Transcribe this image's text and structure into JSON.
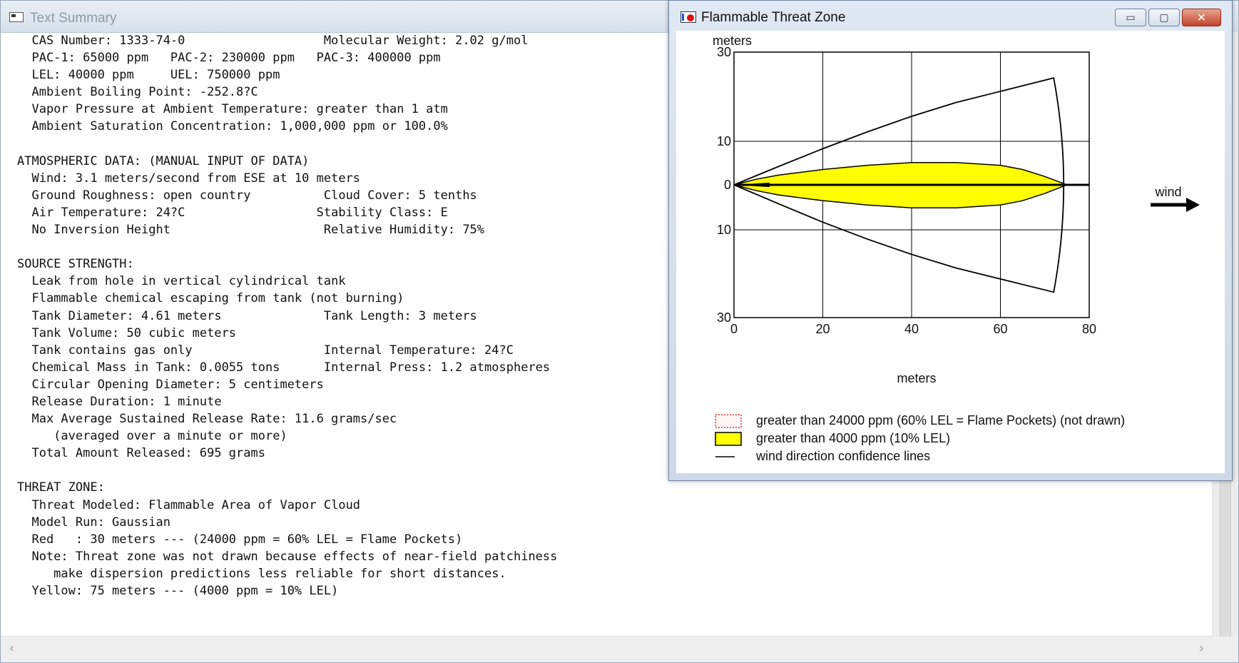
{
  "text_summary": {
    "title": "Text Summary",
    "lines": [
      "CAS Number: 1333-74-0                   Molecular Weight: 2.02 g/mol",
      "PAC-1: 65000 ppm   PAC-2: 230000 ppm   PAC-3: 400000 ppm",
      "LEL: 40000 ppm     UEL: 750000 ppm",
      "Ambient Boiling Point: -252.8?C",
      "Vapor Pressure at Ambient Temperature: greater than 1 atm",
      "Ambient Saturation Concentration: 1,000,000 ppm or 100.0%",
      "",
      "ATMOSPHERIC DATA: (MANUAL INPUT OF DATA)",
      "Wind: 3.1 meters/second from ESE at 10 meters",
      "Ground Roughness: open country          Cloud Cover: 5 tenths",
      "Air Temperature: 24?C                  Stability Class: E",
      "No Inversion Height                     Relative Humidity: 75%",
      "",
      "SOURCE STRENGTH:",
      "Leak from hole in vertical cylindrical tank",
      "Flammable chemical escaping from tank (not burning)",
      "Tank Diameter: 4.61 meters              Tank Length: 3 meters",
      "Tank Volume: 50 cubic meters",
      "Tank contains gas only                  Internal Temperature: 24?C",
      "Chemical Mass in Tank: 0.0055 tons      Internal Press: 1.2 atmospheres",
      "Circular Opening Diameter: 5 centimeters",
      "Release Duration: 1 minute",
      "Max Average Sustained Release Rate: 11.6 grams/sec",
      "   (averaged over a minute or more)",
      "Total Amount Released: 695 grams",
      "",
      "THREAT ZONE:",
      "Threat Modeled: Flammable Area of Vapor Cloud",
      "Model Run: Gaussian",
      "Red   : 30 meters --- (24000 ppm = 60% LEL = Flame Pockets)",
      "Note: Threat zone was not drawn because effects of near-field patchiness",
      "   make dispersion predictions less reliable for short distances.",
      "Yellow: 75 meters --- (4000 ppm = 10% LEL)"
    ],
    "indent": [
      2,
      2,
      2,
      2,
      2,
      2,
      0,
      0,
      2,
      2,
      2,
      2,
      0,
      0,
      2,
      2,
      2,
      2,
      2,
      2,
      2,
      2,
      2,
      2,
      2,
      0,
      0,
      2,
      2,
      2,
      2,
      2,
      2
    ]
  },
  "threat_zone": {
    "title": "Flammable Threat Zone",
    "buttons": {
      "minimize": "▭",
      "maximize": "▢",
      "close": "✕"
    },
    "y_unit_label": "meters",
    "x_axis_label": "meters",
    "wind_label": "wind",
    "x_ticks": [
      "0",
      "20",
      "40",
      "60",
      "80"
    ],
    "y_ticks": [
      "30",
      "10",
      "0",
      "10",
      "30"
    ],
    "legend": [
      {
        "label": "greater than 24000 ppm (60% LEL = Flame Pockets) (not drawn)",
        "swatch": "red-dotted"
      },
      {
        "label": "greater than 4000 ppm (10% LEL)",
        "swatch": "yellow"
      },
      {
        "label": "wind direction confidence lines",
        "swatch": "line"
      }
    ],
    "colors": {
      "yellow_zone": "#ffff00",
      "red_zone": "#e03030",
      "lines": "#000000"
    }
  },
  "chart_data": {
    "type": "area",
    "xlabel": "meters",
    "ylabel": "meters",
    "xlim": [
      0,
      80
    ],
    "ylim": [
      -30,
      30
    ],
    "x_ticks": [
      0,
      20,
      40,
      60,
      80
    ],
    "y_ticks": [
      30,
      10,
      0,
      -10,
      -30
    ],
    "grid": true,
    "series": [
      {
        "name": "greater than 4000 ppm (10% LEL)",
        "x": [
          0,
          5,
          10,
          20,
          30,
          40,
          50,
          60,
          65,
          70,
          75
        ],
        "y_upper": [
          0,
          0.4,
          0.7,
          1.1,
          1.4,
          1.6,
          1.6,
          1.4,
          1.1,
          0.6,
          0
        ],
        "y_lower": [
          0,
          -0.4,
          -0.7,
          -1.1,
          -1.4,
          -1.6,
          -1.6,
          -1.4,
          -1.1,
          -0.6,
          0
        ]
      },
      {
        "name": "wind direction confidence lines",
        "x": [
          0,
          10,
          20,
          30,
          40,
          50,
          60,
          72,
          75,
          76,
          75,
          72
        ],
        "y_upper": [
          0,
          4.2,
          8.3,
          12.1,
          15.6,
          18.7,
          21.2,
          24.2,
          16,
          0,
          -16,
          -24.2
        ],
        "y_lower": [
          0,
          -4.2,
          -8.3,
          -12.1,
          -15.6,
          -18.7,
          -21.2,
          -24.2,
          -16,
          0,
          16,
          24.2
        ]
      }
    ]
  }
}
